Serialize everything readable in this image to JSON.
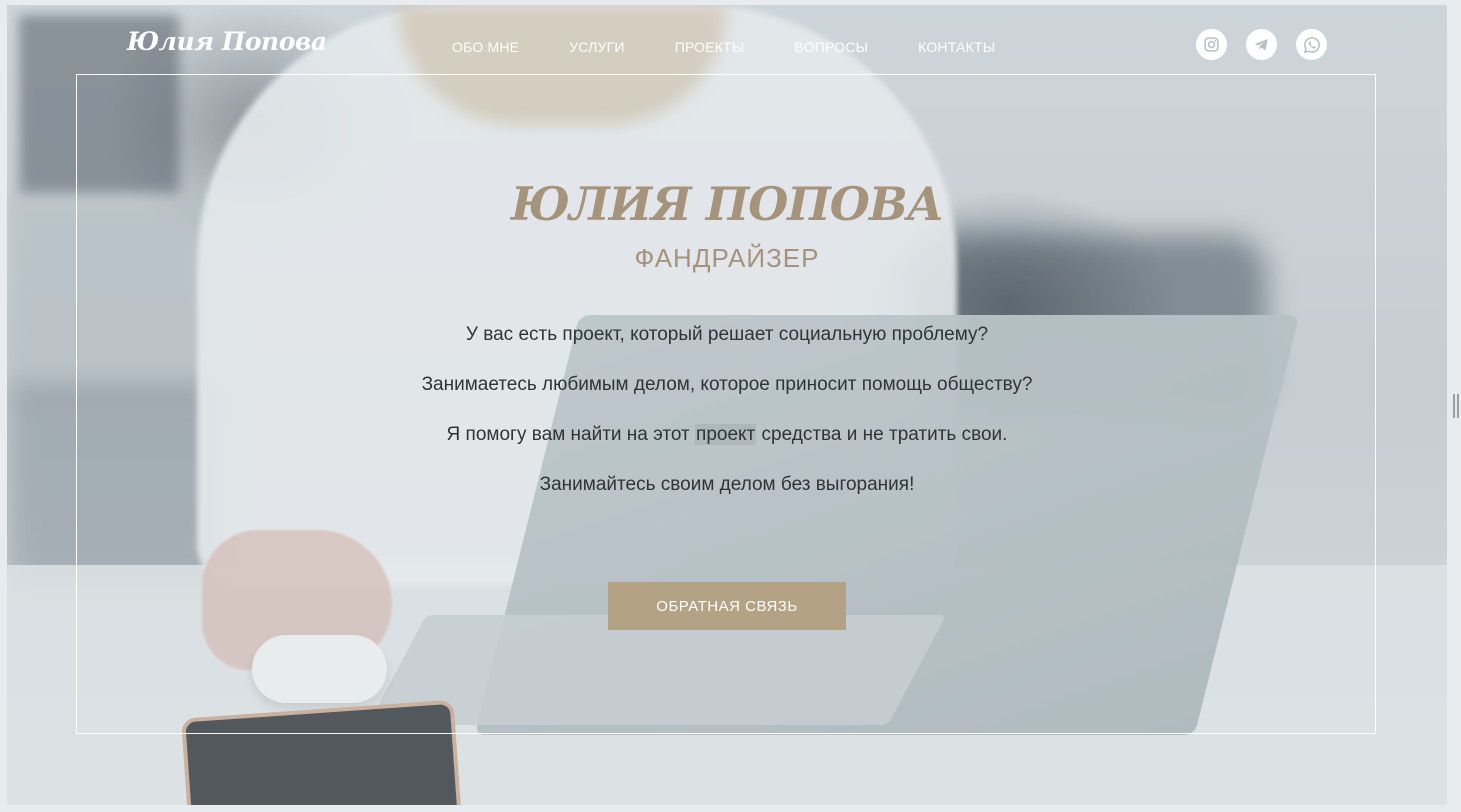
{
  "header": {
    "logo": "Юлия Попова",
    "nav": [
      "ОБО МНЕ",
      "УСЛУГИ",
      "ПРОЕКТЫ",
      "ВОПРОСЫ",
      "КОНТАКТЫ"
    ],
    "socials": [
      "instagram-icon",
      "telegram-icon",
      "whatsapp-icon"
    ]
  },
  "hero": {
    "title": "ЮЛИЯ ПОПОВА",
    "subtitle": "ФАНДРАЙЗЕР",
    "line1": "У вас есть проект, который решает социальную проблему?",
    "line2": "Занимаетесь любимым делом, которое приносит помощь обществу?",
    "line3_before": "Я помогу вам найти на этот ",
    "line3_highlight": "проект",
    "line3_after": " средства и не тратить свои.",
    "line4": "Занимайтесь своим делом без выгорания!",
    "cta": "ОБРАТНАЯ СВЯЗЬ"
  },
  "colors": {
    "accent": "#b3a283",
    "title": "#a6937b",
    "text": "#2f3438"
  }
}
